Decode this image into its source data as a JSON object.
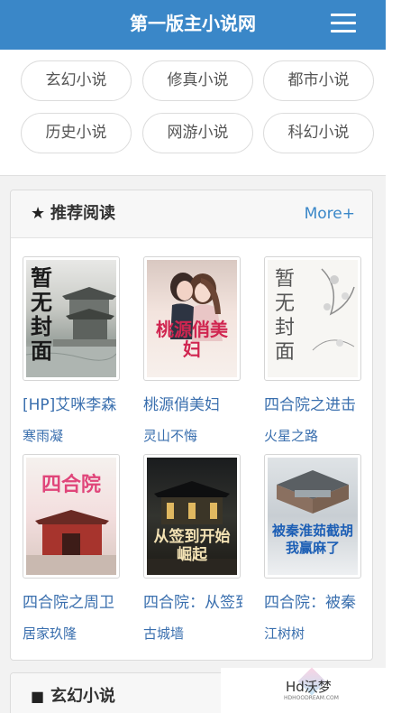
{
  "header": {
    "title": "第一版主小说网",
    "menu_icon": "hamburger-menu-icon",
    "bg_color": "#3a87c8"
  },
  "categories": [
    "玄幻小说",
    "修真小说",
    "都市小说",
    "历史小说",
    "网游小说",
    "科幻小说"
  ],
  "recommend": {
    "icon": "star-icon",
    "icon_glyph": "★",
    "title": "推荐阅读",
    "more_label": "More+",
    "books": [
      {
        "title": "[HP]艾咪李森",
        "author": "寒雨凝",
        "cover_text": "暂无封面"
      },
      {
        "title": "桃源俏美妇",
        "author": "灵山不悔",
        "cover_text": "桃源俏美妇"
      },
      {
        "title": "四合院之进击",
        "author": "火星之路",
        "cover_text": "暂无封面"
      },
      {
        "title": "四合院之周卫",
        "author": "居家玖隆",
        "cover_text": "四合院"
      },
      {
        "title": "四合院：从签到",
        "author": "古城墙",
        "cover_text": "从签到开始崛起"
      },
      {
        "title": "四合院：被秦",
        "author": "江树树",
        "cover_text": "被秦淮茹截胡我赢麻了"
      }
    ]
  },
  "xuanhuan": {
    "icon": "grid-icon",
    "icon_glyph": "■",
    "title": "玄幻小说"
  },
  "watermark": {
    "text": "Hd沃梦",
    "sub": "HDHOODREAM.COM"
  }
}
